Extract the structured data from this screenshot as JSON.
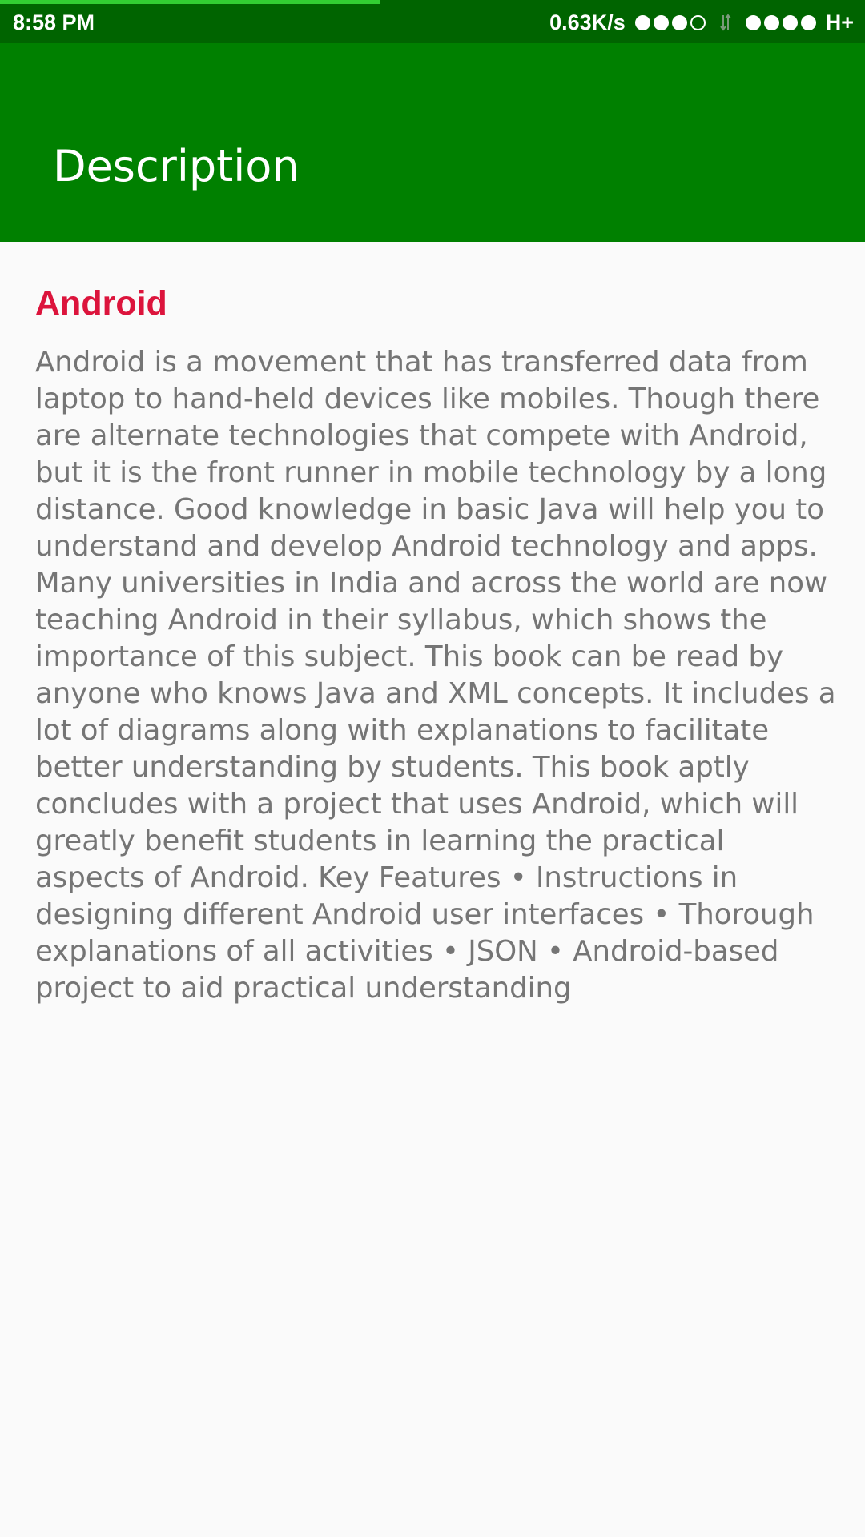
{
  "status_bar": {
    "time": "8:58 PM",
    "network_speed": "0.63K/s",
    "network_type": "H+",
    "signal1_filled": 3,
    "signal1_total": 4,
    "signal2_filled": 4,
    "signal2_total": 4,
    "load_progress_percent": 44,
    "icons": [
      "signal-strength-icon",
      "data-arrows-icon",
      "signal-strength-icon"
    ],
    "colors": {
      "background": "#006400",
      "progress": "#32cd32"
    }
  },
  "app_bar": {
    "title": "Description",
    "color": "#008000"
  },
  "content": {
    "title": "Android",
    "title_color": "#dc143c",
    "description": "Android is a movement that has transferred data from laptop to hand-held devices like mobiles. Though there are alternate technologies that compete with Android, but it is the front runner in mobile technology by a long distance. Good knowledge in basic Java will help you to understand and develop Android technology and apps. Many universities in India and across the world are now teaching Android in their syllabus, which shows the importance of this subject. This book can be read by anyone who knows Java and XML concepts. It includes a lot of diagrams along with explanations to facilitate better understanding by students. This book aptly concludes with a project that uses Android, which will greatly benefit students in learning the practical aspects of Android. Key Features • Instructions in designing different Android user interfaces • Thorough explanations of all activities • JSON • Android-based project to aid practical understanding",
    "text_color": "#757575"
  }
}
